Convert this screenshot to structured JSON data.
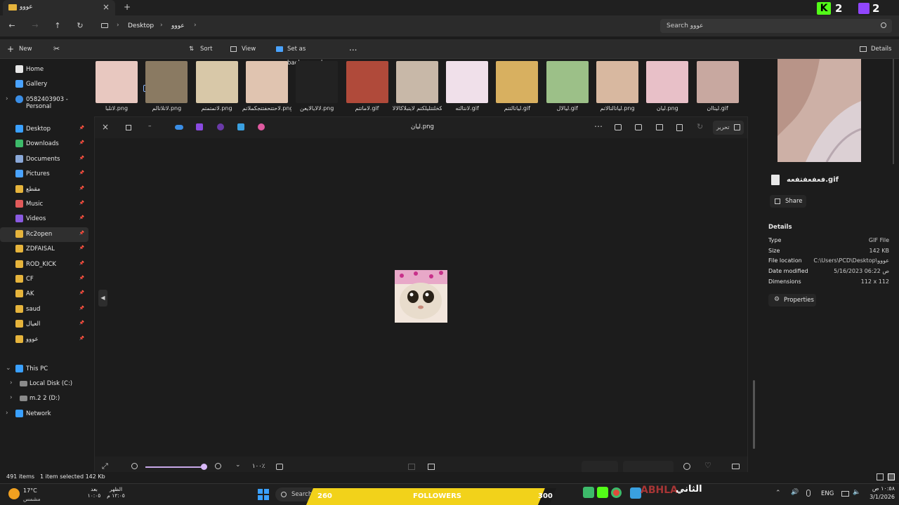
{
  "window": {
    "tab_title": "عووو",
    "add_tab": "+",
    "close": "×"
  },
  "address": {
    "crumbs": [
      "Desktop",
      "عووو"
    ],
    "search_placeholder": "Search عووو"
  },
  "overlay": {
    "k_count": "2",
    "twitch_count": "2"
  },
  "commandbar": {
    "new": "New",
    "sort": "Sort",
    "view": "View",
    "set_bg": "Set as background",
    "more": "...",
    "details": "Details"
  },
  "sidebar": {
    "top": [
      {
        "label": "Home",
        "color": "#e8e8e8"
      },
      {
        "label": "Gallery",
        "color": "#4aa3ff"
      },
      {
        "label": "0582403903 - Personal",
        "color": "#3a8ee6"
      }
    ],
    "pinned": [
      {
        "label": "Desktop",
        "color": "#3aa0ff"
      },
      {
        "label": "Downloads",
        "color": "#3dba6a"
      },
      {
        "label": "Documents",
        "color": "#8aa8d8"
      },
      {
        "label": "Pictures",
        "color": "#4aa3ff"
      },
      {
        "label": "مقطع",
        "color": "#e6b43c"
      },
      {
        "label": "Music",
        "color": "#e05a5a"
      },
      {
        "label": "Videos",
        "color": "#8a5ae0"
      },
      {
        "label": "Rc2open",
        "color": "#e6b43c"
      },
      {
        "label": "ZDFAISAL",
        "color": "#e6b43c"
      },
      {
        "label": "ROD_KICK",
        "color": "#e6b43c"
      },
      {
        "label": "CF",
        "color": "#e6b43c"
      },
      {
        "label": "AK",
        "color": "#e6b43c"
      },
      {
        "label": "saud",
        "color": "#e6b43c"
      },
      {
        "label": "العيال",
        "color": "#e6b43c"
      },
      {
        "label": "عووو",
        "color": "#e6b43c"
      }
    ],
    "pc": {
      "label": "This PC"
    },
    "drives": [
      {
        "label": "Local Disk (C:)"
      },
      {
        "label": "m.2 2 (D:)"
      }
    ],
    "network": {
      "label": "Network"
    }
  },
  "thumbnails": [
    {
      "label": "لاتلبا.png",
      "color": "#e8c8c0"
    },
    {
      "label": "لاتلاتالم.png",
      "color": "#8a7a62"
    },
    {
      "label": "لاتمتمتم.png",
      "color": "#d8c8a8"
    },
    {
      "label": "لاحتتحفتتجكملاتم.png",
      "color": "#e0c4b0"
    },
    {
      "label": "لالايالايعن.png",
      "color": "#222222"
    },
    {
      "label": "لاماتتم.gif",
      "color": "#b04a3a"
    },
    {
      "label": "لاملتلتتبلكخلتتليلكتم لايتبلاكالالا.png",
      "color": "#c8b8a8"
    },
    {
      "label": "لانتالته.gif",
      "color": "#f0e0ea"
    },
    {
      "label": "لياتالتتم.gif",
      "color": "#d8b060"
    },
    {
      "label": "ليالال.gif",
      "color": "#9cc088"
    },
    {
      "label": "لياتالتالاتم.png",
      "color": "#d8b8a0"
    },
    {
      "label": "ليان.png",
      "color": "#e8c0c8"
    },
    {
      "label": "ليتاان.gif",
      "color": "#c8a8a0"
    }
  ],
  "viewer": {
    "title": "ليان.png",
    "edit": "تحرير",
    "zoom": "١٠٠٪",
    "zoom_level": 0.95
  },
  "details": {
    "filename": "فعفعفتفعه.gif",
    "share": "Share",
    "heading": "Details",
    "rows": [
      {
        "k": "Type",
        "v": "GIF File"
      },
      {
        "k": "Size",
        "v": "142 KB"
      },
      {
        "k": "File location",
        "v": "C:\\Users\\PCD\\Desktop\\عووو"
      },
      {
        "k": "Date modified",
        "v": "5/16/2023 06:22 ص"
      },
      {
        "k": "Dimensions",
        "v": "112 x 112"
      }
    ],
    "properties": "Properties"
  },
  "status": {
    "items": "491 items",
    "selected": "1 item selected  142 Kb"
  },
  "taskbar": {
    "temp": "17°C",
    "weather": "مشمس",
    "w2_top": "بعد",
    "w2_bottom": "١٠:٠٥",
    "w3_top": "الظهر",
    "w3_bottom": "١٢:٠٥ م",
    "search": "Search",
    "stream_left": "260",
    "stream_mid": "FOLLOWERS",
    "stream_right": "300",
    "brand": "ABHLA",
    "second": "الثاني",
    "lang": "ENG",
    "time": "١٠:٥٨ ص",
    "date": "3/1/2026"
  }
}
